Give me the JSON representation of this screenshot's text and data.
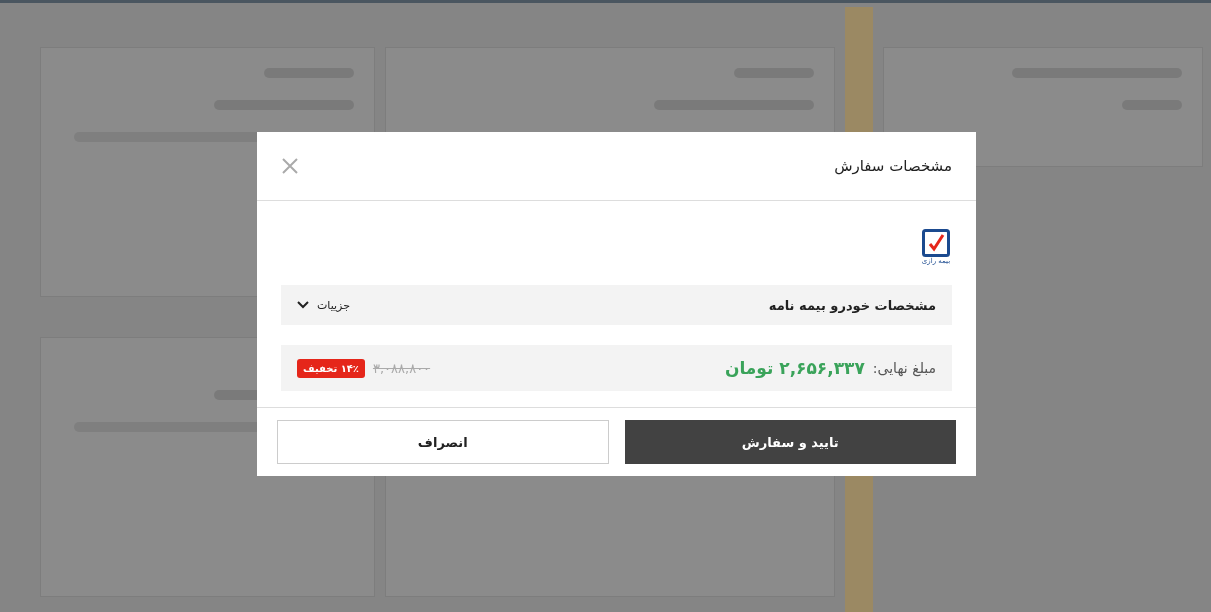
{
  "dialog": {
    "title": "مشخصات سفارش",
    "logo": {
      "caption": "بیمه رازی"
    },
    "spec_row": {
      "label": "مشخصات خودرو بیمه نامه",
      "toggle": "جزییات",
      "expanded": false
    },
    "price": {
      "label": "مبلغ نهایی:",
      "final": "۲,۶۵۶,۳۳۷ تومان",
      "original": "۳,۰۸۸,۸۰۰",
      "discount": "۱۴٪ تخفیف"
    },
    "buttons": [
      {
        "label": "تایید و سفارش",
        "kind": "primary"
      },
      {
        "label": "انصراف",
        "kind": "secondary"
      }
    ]
  }
}
